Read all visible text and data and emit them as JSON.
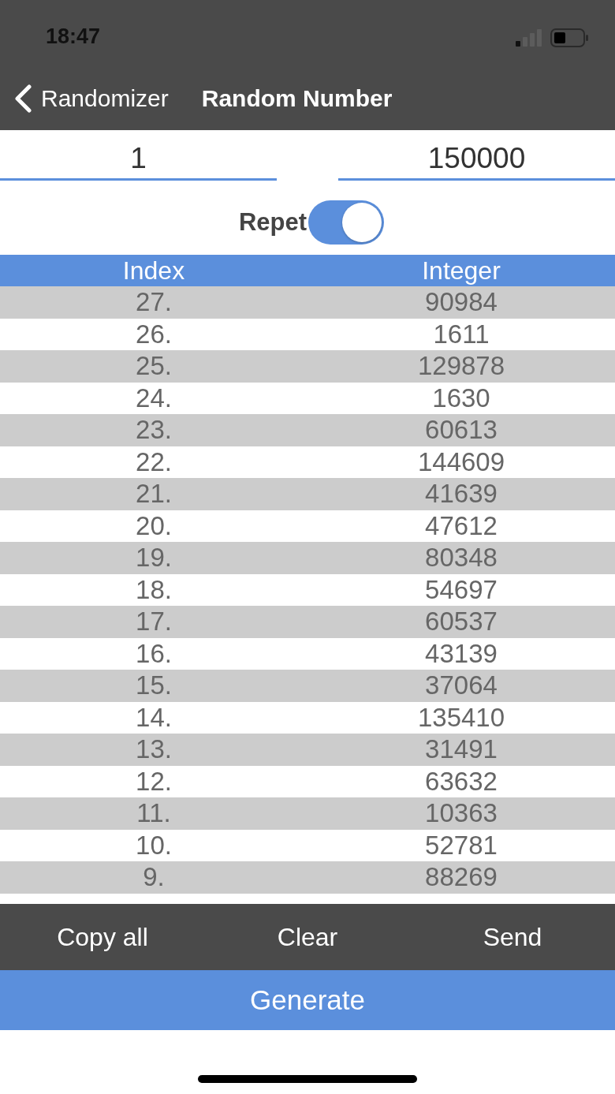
{
  "status_bar": {
    "time": "18:47"
  },
  "nav": {
    "back_label": "Randomizer",
    "title": "Random Number"
  },
  "range": {
    "min": "1",
    "max": "150000"
  },
  "repeat_toggle": {
    "label": "Repet",
    "on": true
  },
  "table": {
    "columns": [
      "Index",
      "Integer"
    ],
    "rows": [
      {
        "index": "27.",
        "value": "90984"
      },
      {
        "index": "26.",
        "value": "1611"
      },
      {
        "index": "25.",
        "value": "129878"
      },
      {
        "index": "24.",
        "value": "1630"
      },
      {
        "index": "23.",
        "value": "60613"
      },
      {
        "index": "22.",
        "value": "144609"
      },
      {
        "index": "21.",
        "value": "41639"
      },
      {
        "index": "20.",
        "value": "47612"
      },
      {
        "index": "19.",
        "value": "80348"
      },
      {
        "index": "18.",
        "value": "54697"
      },
      {
        "index": "17.",
        "value": "60537"
      },
      {
        "index": "16.",
        "value": "43139"
      },
      {
        "index": "15.",
        "value": "37064"
      },
      {
        "index": "14.",
        "value": "135410"
      },
      {
        "index": "13.",
        "value": "31491"
      },
      {
        "index": "12.",
        "value": "63632"
      },
      {
        "index": "11.",
        "value": "10363"
      },
      {
        "index": "10.",
        "value": "52781"
      },
      {
        "index": "9.",
        "value": "88269"
      }
    ]
  },
  "toolbar": {
    "buttons": [
      "Copy all",
      "Clear",
      "Send"
    ]
  },
  "generate_button": {
    "label": "Generate"
  }
}
